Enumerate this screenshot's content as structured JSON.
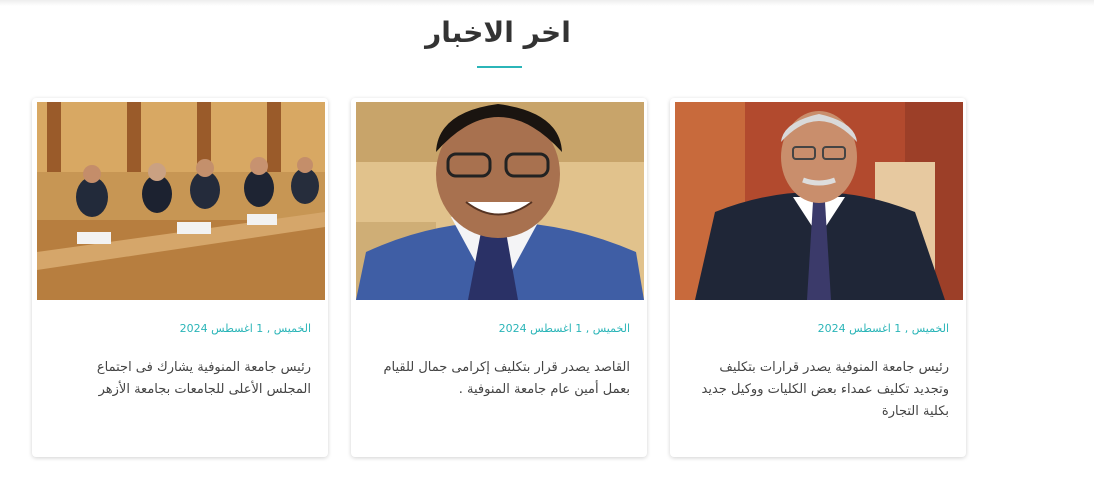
{
  "section": {
    "title": "اخر الاخبار",
    "accent_color": "#2bb5b8"
  },
  "news": [
    {
      "date": "الخميس , 1 اغسطس 2024",
      "headline": "رئيس جامعة المنوفية يصدر قرارات بتكليف وتجديد تكليف عمداء بعض الكليات ووكيل جديد بكلية التجارة",
      "image": "portrait-official-photo"
    },
    {
      "date": "الخميس , 1 اغسطس 2024",
      "headline": "القاصد يصدر قرار بتكليف إكرامى جمال للقيام بعمل أمين عام جامعة المنوفية .",
      "image": "portrait-smiling-man-photo"
    },
    {
      "date": "الخميس , 1 اغسطس 2024",
      "headline": "رئيس جامعة المنوفية يشارك فى اجتماع المجلس الأعلى للجامعات بجامعة الأزهر",
      "image": "council-meeting-photo"
    }
  ]
}
